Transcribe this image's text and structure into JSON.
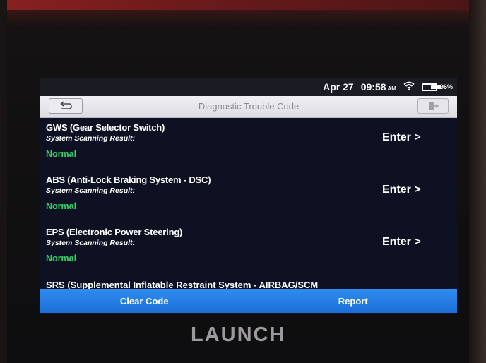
{
  "status_bar": {
    "date": "Apr 27",
    "time": "09:58",
    "ampm": "AM",
    "battery": "96%",
    "battery_level": 0.96
  },
  "header": {
    "title": "Diagnostic Trouble Code"
  },
  "systems": [
    {
      "name": "GWS (Gear Selector Switch)",
      "scan_label": "System Scanning Result:",
      "status": "Normal",
      "action": "Enter >"
    },
    {
      "name": "ABS (Anti-Lock Braking System - DSC)",
      "scan_label": "System Scanning Result:",
      "status": "Normal",
      "action": "Enter >"
    },
    {
      "name": "EPS (Electronic Power Steering)",
      "scan_label": "System Scanning Result:",
      "status": "Normal",
      "action": "Enter >"
    }
  ],
  "partial_row": "SRS (Supplemental Inflatable Restraint System - AIRBAG/SCM",
  "footer": {
    "clear_code": "Clear Code",
    "report": "Report"
  },
  "brand": "LAUNCH",
  "colors": {
    "normal_status": "#2fd36a",
    "button_blue": "#1b6fd8",
    "screen_bg": "#0d1122"
  }
}
